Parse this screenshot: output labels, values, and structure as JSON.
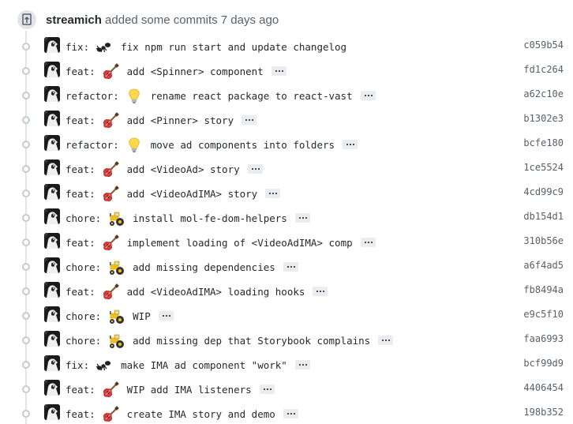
{
  "header": {
    "actor": "streamich",
    "action": "added some commits 7 days ago",
    "icon": "repo-push-icon"
  },
  "commits": [
    {
      "type": "fix:",
      "emoji": "ant",
      "text": "fix npm run start and update changelog",
      "sha": "c059b54",
      "expand": false
    },
    {
      "type": "feat:",
      "emoji": "guitar",
      "text": "add <Spinner> component",
      "sha": "fd1c264",
      "expand": true
    },
    {
      "type": "refactor:",
      "emoji": "bulb",
      "text": "rename react package to react-vast",
      "sha": "a62c10e",
      "expand": true
    },
    {
      "type": "feat:",
      "emoji": "guitar",
      "text": "add <Pinner> story",
      "sha": "b1302e3",
      "expand": true
    },
    {
      "type": "refactor:",
      "emoji": "bulb",
      "text": "move ad components into folders",
      "sha": "bcfe180",
      "expand": true
    },
    {
      "type": "feat:",
      "emoji": "guitar",
      "text": "add <VideoAd> story",
      "sha": "1ce5524",
      "expand": true
    },
    {
      "type": "feat:",
      "emoji": "guitar",
      "text": "add <VideoAdIMA> story",
      "sha": "4cd99c9",
      "expand": true
    },
    {
      "type": "chore:",
      "emoji": "tractor",
      "text": "install mol-fe-dom-helpers",
      "sha": "db154d1",
      "expand": true
    },
    {
      "type": "feat:",
      "emoji": "guitar",
      "text": "implement loading of <VideoAdIMA> comp",
      "sha": "310b56e",
      "expand": true
    },
    {
      "type": "chore:",
      "emoji": "tractor",
      "text": "add missing dependencies",
      "sha": "a6f4ad5",
      "expand": true
    },
    {
      "type": "feat:",
      "emoji": "guitar",
      "text": "add <VideoAdIMA> loading hooks",
      "sha": "fb8494a",
      "expand": true
    },
    {
      "type": "chore:",
      "emoji": "tractor",
      "text": "WIP",
      "sha": "e9c5f10",
      "expand": true
    },
    {
      "type": "chore:",
      "emoji": "tractor",
      "text": "add missing dep that Storybook complains",
      "sha": "faa6993",
      "expand": true
    },
    {
      "type": "fix:",
      "emoji": "ant",
      "text": "make IMA ad component \"work\"",
      "sha": "bcf99d9",
      "expand": true
    },
    {
      "type": "feat:",
      "emoji": "guitar",
      "text": "WIP add IMA listeners",
      "sha": "4406454",
      "expand": true
    },
    {
      "type": "feat:",
      "emoji": "guitar",
      "text": "create IMA story and demo",
      "sha": "198b352",
      "expand": true
    }
  ],
  "colors": {
    "sha": "#586069",
    "timeline": "#e1e4e8",
    "ellipsis_bg": "#eaecef"
  }
}
